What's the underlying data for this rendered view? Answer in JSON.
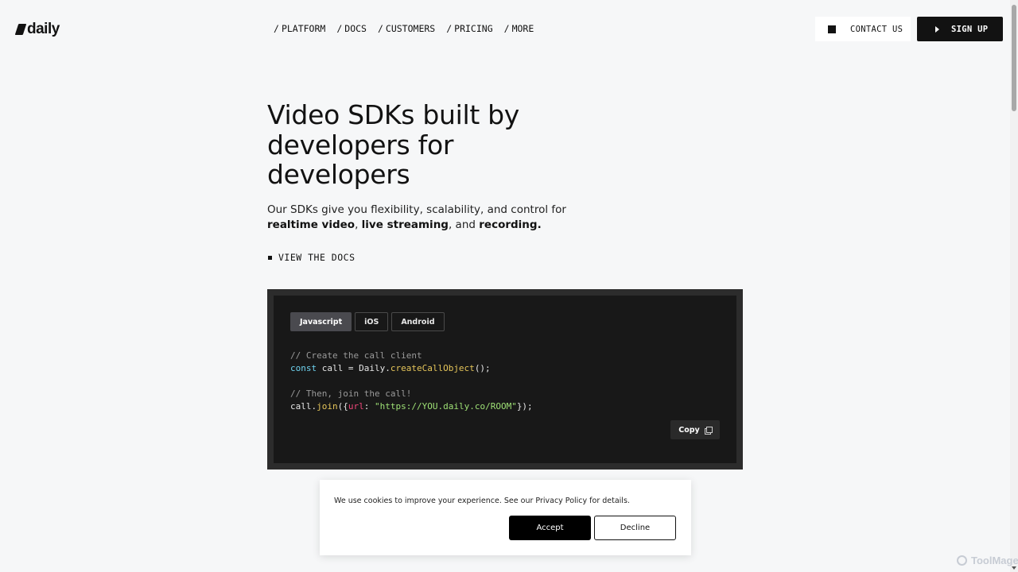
{
  "brand": {
    "name": "daily"
  },
  "nav": {
    "items": [
      {
        "label": "PLATFORM"
      },
      {
        "label": "DOCS"
      },
      {
        "label": "CUSTOMERS"
      },
      {
        "label": "PRICING"
      },
      {
        "label": "MORE"
      }
    ],
    "slash": "/"
  },
  "header": {
    "contact_label": "CONTACT US",
    "signup_label": "SIGN UP"
  },
  "hero": {
    "title": "Video SDKs built by developers for developers",
    "subtitle_prefix": "Our SDKs give you flexibility, scalability, and control for ",
    "bold1": "realtime video",
    "sep1": ", ",
    "bold2": "live streaming",
    "sep2": ", and ",
    "bold3": "recording."
  },
  "docs_link": {
    "label": "VIEW THE DOCS"
  },
  "code_panel": {
    "tabs": [
      {
        "label": "Javascript",
        "active": true
      },
      {
        "label": "iOS",
        "active": false
      },
      {
        "label": "Android",
        "active": false
      }
    ],
    "lines": {
      "l1_comment": "// Create the call client",
      "l2_kw": "const",
      "l2_a": " call = Daily.",
      "l2_fn": "createCallObject",
      "l2_b": "();",
      "l4_comment": "// Then, join the call!",
      "l5_a": "call.",
      "l5_fn": "join",
      "l5_b": "({",
      "l5_prop": "url",
      "l5_c": ": ",
      "l5_str": "\"https://YOU.daily.co/ROOM\"",
      "l5_d": "});"
    },
    "copy_label": "Copy"
  },
  "cookie_banner": {
    "text_prefix": "We use cookies to improve your experience. See our ",
    "link": "Privacy Policy",
    "text_suffix": " for details.",
    "accept_label": "Accept",
    "decline_label": "Decline"
  },
  "watermark": {
    "text": "ToolMage"
  },
  "colors": {
    "background": "#f6f7f8",
    "primary": "#121212",
    "code_bg": "#181818",
    "code_frame": "#2c2c2c",
    "keyword": "#6fd3f0",
    "function": "#e6c65a",
    "property": "#f0477a",
    "string": "#9fe276"
  }
}
